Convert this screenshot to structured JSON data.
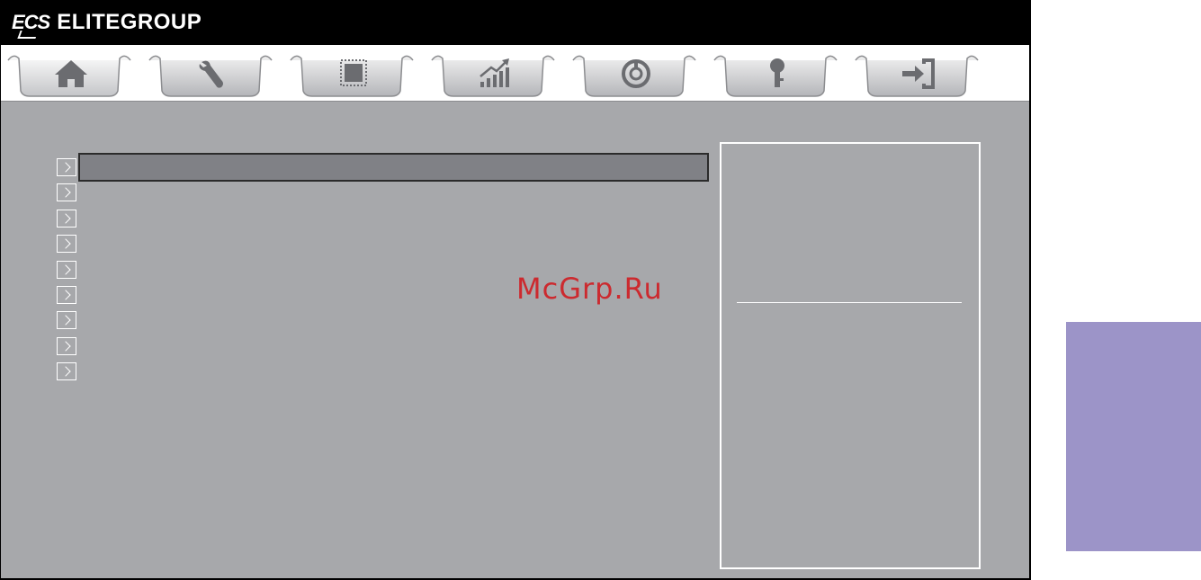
{
  "brand": {
    "logo": "ECS",
    "name": "ELITEGROUP"
  },
  "tabs": [
    {
      "icon": "home-icon",
      "selected": true
    },
    {
      "icon": "wrench-icon",
      "selected": false
    },
    {
      "icon": "chip-icon",
      "selected": false
    },
    {
      "icon": "chart-icon",
      "selected": false
    },
    {
      "icon": "power-icon",
      "selected": false
    },
    {
      "icon": "key-icon",
      "selected": false
    },
    {
      "icon": "exit-icon",
      "selected": false
    }
  ],
  "menu": {
    "items": [
      {
        "label": "",
        "selected": true
      },
      {
        "label": ""
      },
      {
        "label": ""
      },
      {
        "label": ""
      },
      {
        "label": ""
      },
      {
        "label": ""
      },
      {
        "label": ""
      },
      {
        "label": ""
      },
      {
        "label": ""
      }
    ]
  },
  "watermark": "McGrp.Ru",
  "colors": {
    "background": "#a7a8ab",
    "selection": "#808186",
    "side_block": "#9c94c8",
    "watermark": "#cc2a2f"
  }
}
